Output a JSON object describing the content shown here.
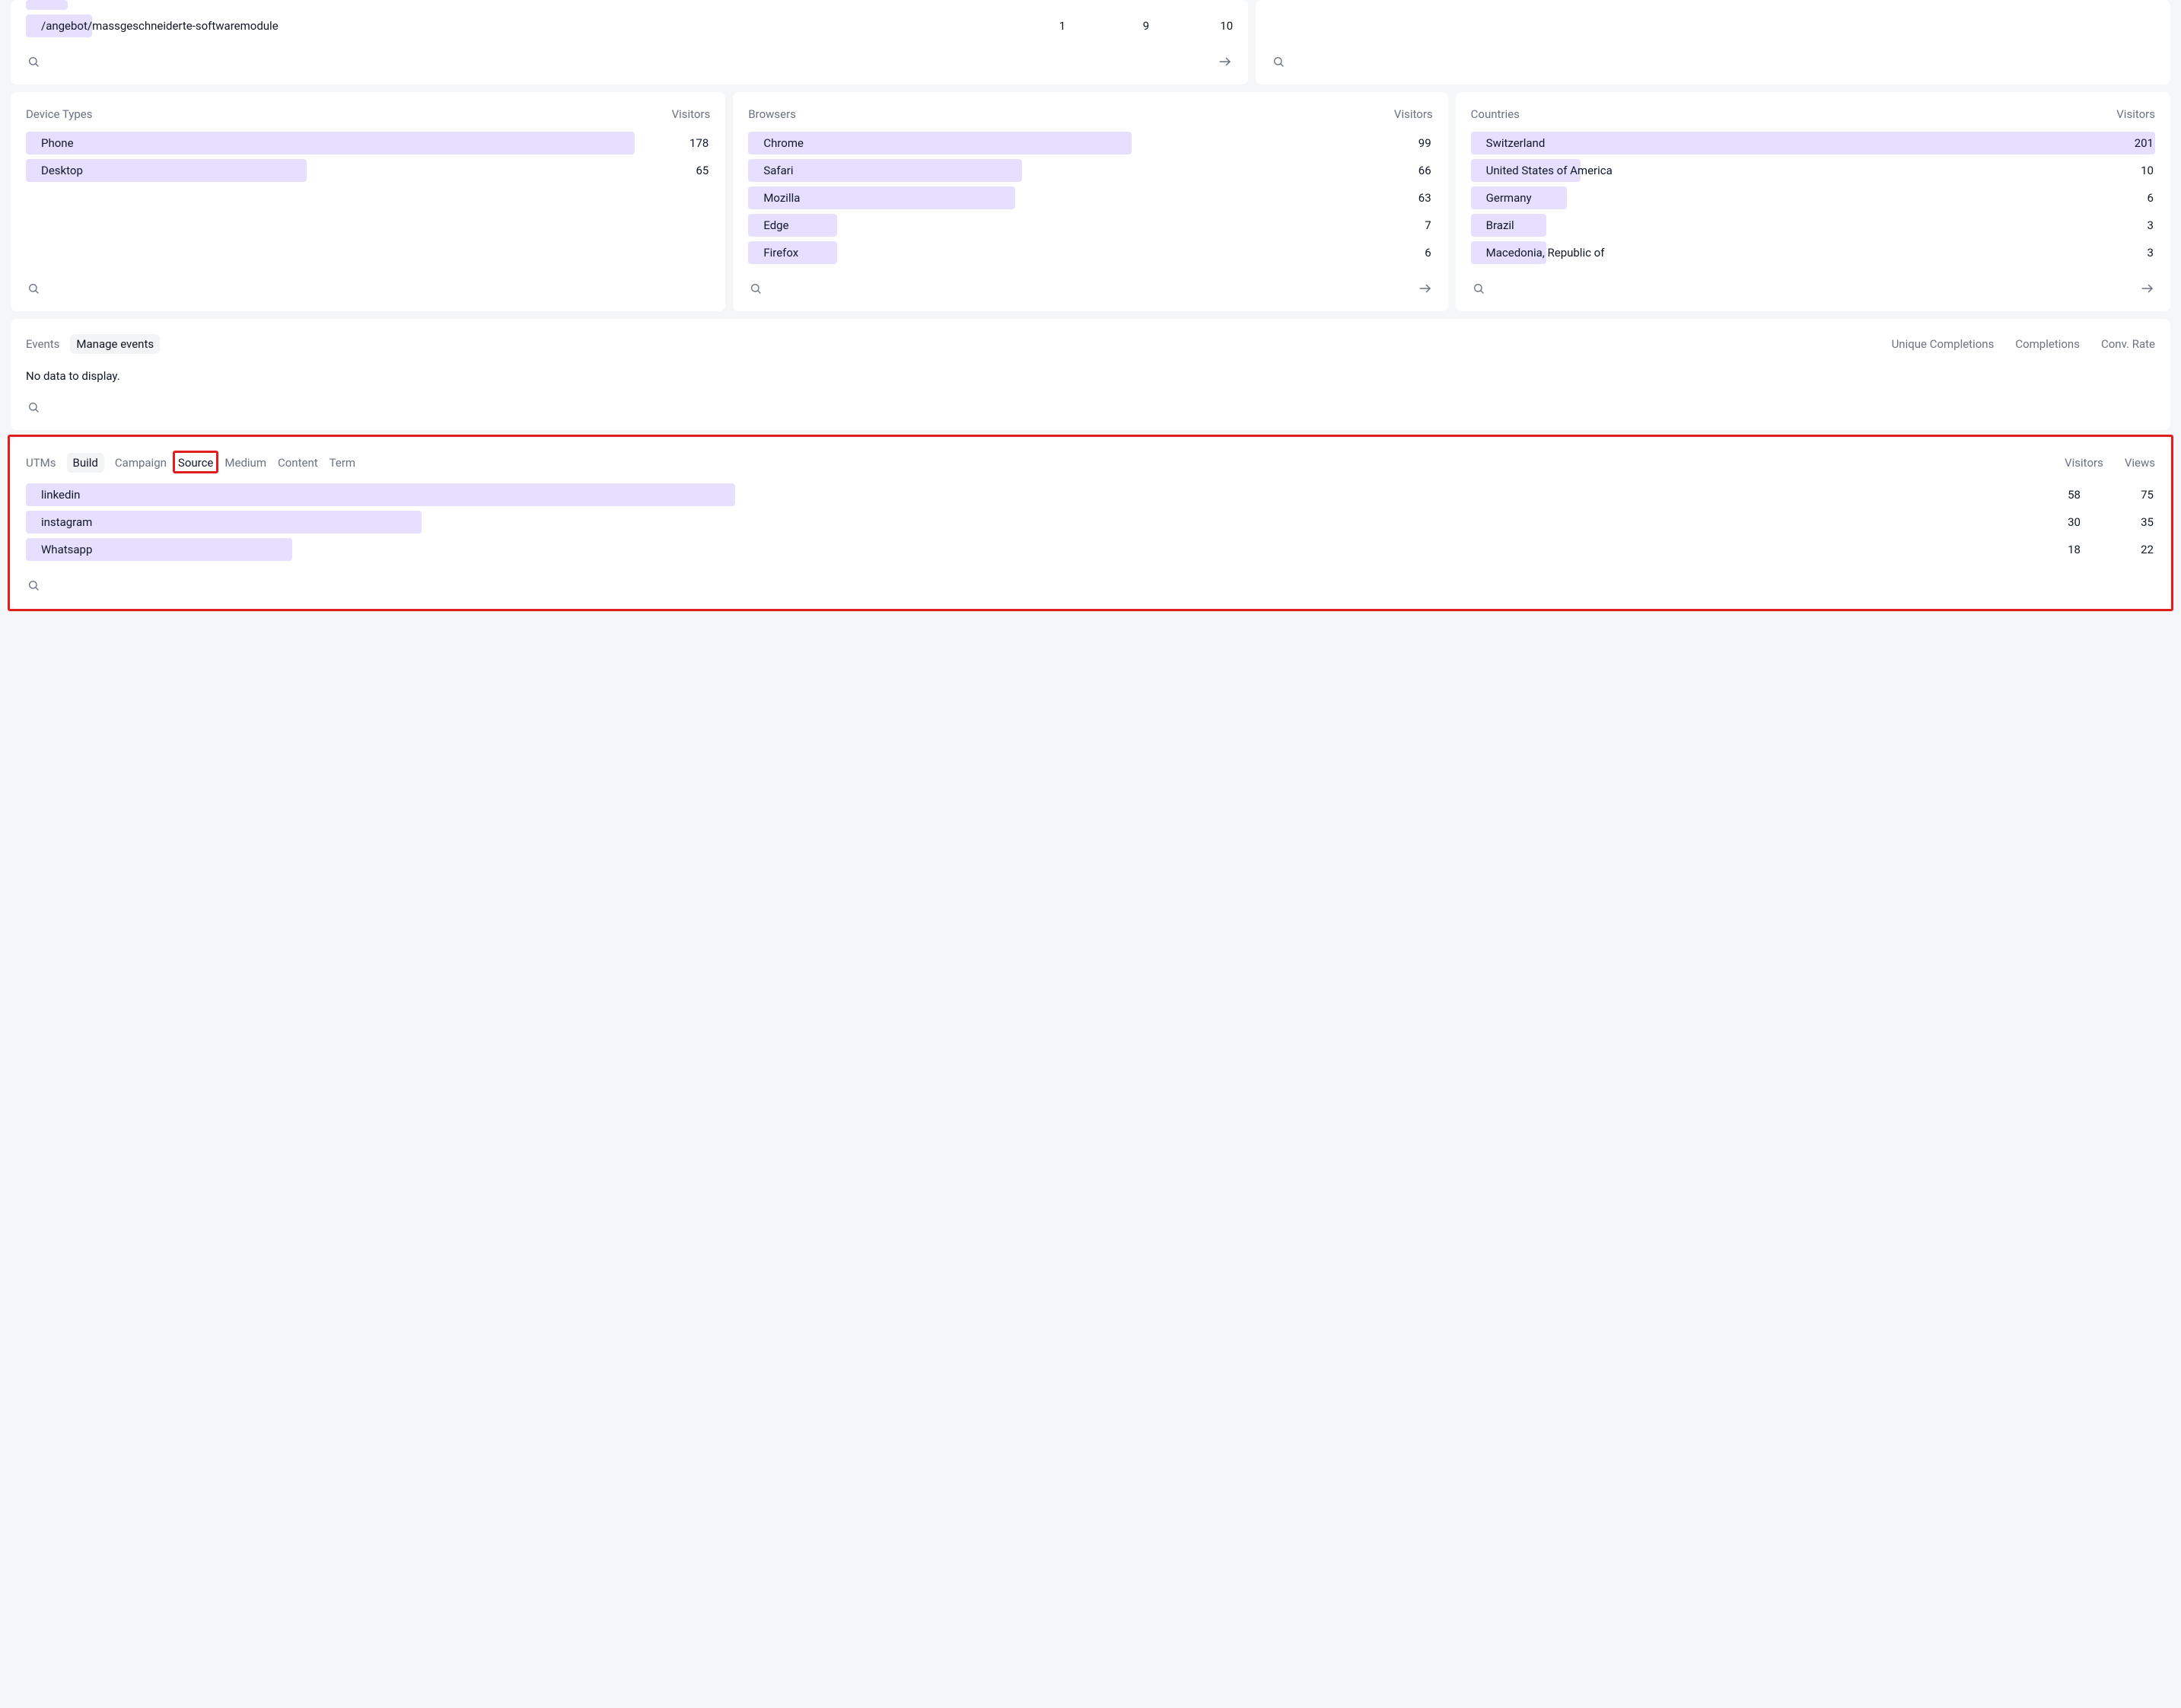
{
  "top": {
    "path": "/angebot/massgeschneiderte-softwaremodule",
    "cols": [
      1,
      9,
      10
    ],
    "bar_ratio": 0.055
  },
  "device_types": {
    "title": "Device Types",
    "metric": "Visitors",
    "rows": [
      {
        "label": "Phone",
        "value": 178,
        "bar_ratio": 0.89
      },
      {
        "label": "Desktop",
        "value": 65,
        "bar_ratio": 0.41
      }
    ]
  },
  "browsers": {
    "title": "Browsers",
    "metric": "Visitors",
    "rows": [
      {
        "label": "Chrome",
        "value": 99,
        "bar_ratio": 0.56
      },
      {
        "label": "Safari",
        "value": 66,
        "bar_ratio": 0.4
      },
      {
        "label": "Mozilla",
        "value": 63,
        "bar_ratio": 0.39
      },
      {
        "label": "Edge",
        "value": 7,
        "bar_ratio": 0.13
      },
      {
        "label": "Firefox",
        "value": 6,
        "bar_ratio": 0.13
      }
    ]
  },
  "countries": {
    "title": "Countries",
    "metric": "Visitors",
    "rows": [
      {
        "label": "Switzerland",
        "value": 201,
        "bar_ratio": 1.0
      },
      {
        "label": "United States of America",
        "value": 10,
        "bar_ratio": 0.16
      },
      {
        "label": "Germany",
        "value": 6,
        "bar_ratio": 0.14
      },
      {
        "label": "Brazil",
        "value": 3,
        "bar_ratio": 0.11
      },
      {
        "label": "Macedonia, Republic of",
        "value": 3,
        "bar_ratio": 0.11
      }
    ]
  },
  "events": {
    "title": "Events",
    "manage_label": "Manage events",
    "metrics": [
      "Unique Completions",
      "Completions",
      "Conv. Rate"
    ],
    "no_data": "No data to display."
  },
  "utms": {
    "title": "UTMs",
    "build_label": "Build",
    "tabs": [
      {
        "label": "Campaign",
        "active": false
      },
      {
        "label": "Source",
        "active": true
      },
      {
        "label": "Medium",
        "active": false
      },
      {
        "label": "Content",
        "active": false
      },
      {
        "label": "Term",
        "active": false
      }
    ],
    "metrics": [
      "Visitors",
      "Views"
    ],
    "rows": [
      {
        "label": "linkedin",
        "visitors": 58,
        "views": 75,
        "bar_ratio": 0.333
      },
      {
        "label": "instagram",
        "visitors": 30,
        "views": 35,
        "bar_ratio": 0.186
      },
      {
        "label": "Whatsapp",
        "visitors": 18,
        "views": 22,
        "bar_ratio": 0.125
      }
    ]
  },
  "chart_data": [
    {
      "type": "bar",
      "title": "Device Types",
      "categories": [
        "Phone",
        "Desktop"
      ],
      "values": [
        178,
        65
      ],
      "ylabel": "Visitors"
    },
    {
      "type": "bar",
      "title": "Browsers",
      "categories": [
        "Chrome",
        "Safari",
        "Mozilla",
        "Edge",
        "Firefox"
      ],
      "values": [
        99,
        66,
        63,
        7,
        6
      ],
      "ylabel": "Visitors"
    },
    {
      "type": "bar",
      "title": "Countries",
      "categories": [
        "Switzerland",
        "United States of America",
        "Germany",
        "Brazil",
        "Macedonia, Republic of"
      ],
      "values": [
        201,
        10,
        6,
        3,
        3
      ],
      "ylabel": "Visitors"
    },
    {
      "type": "bar",
      "title": "UTMs — Source",
      "categories": [
        "linkedin",
        "instagram",
        "Whatsapp"
      ],
      "series": [
        {
          "name": "Visitors",
          "values": [
            58,
            30,
            18
          ]
        },
        {
          "name": "Views",
          "values": [
            75,
            35,
            22
          ]
        }
      ]
    }
  ]
}
